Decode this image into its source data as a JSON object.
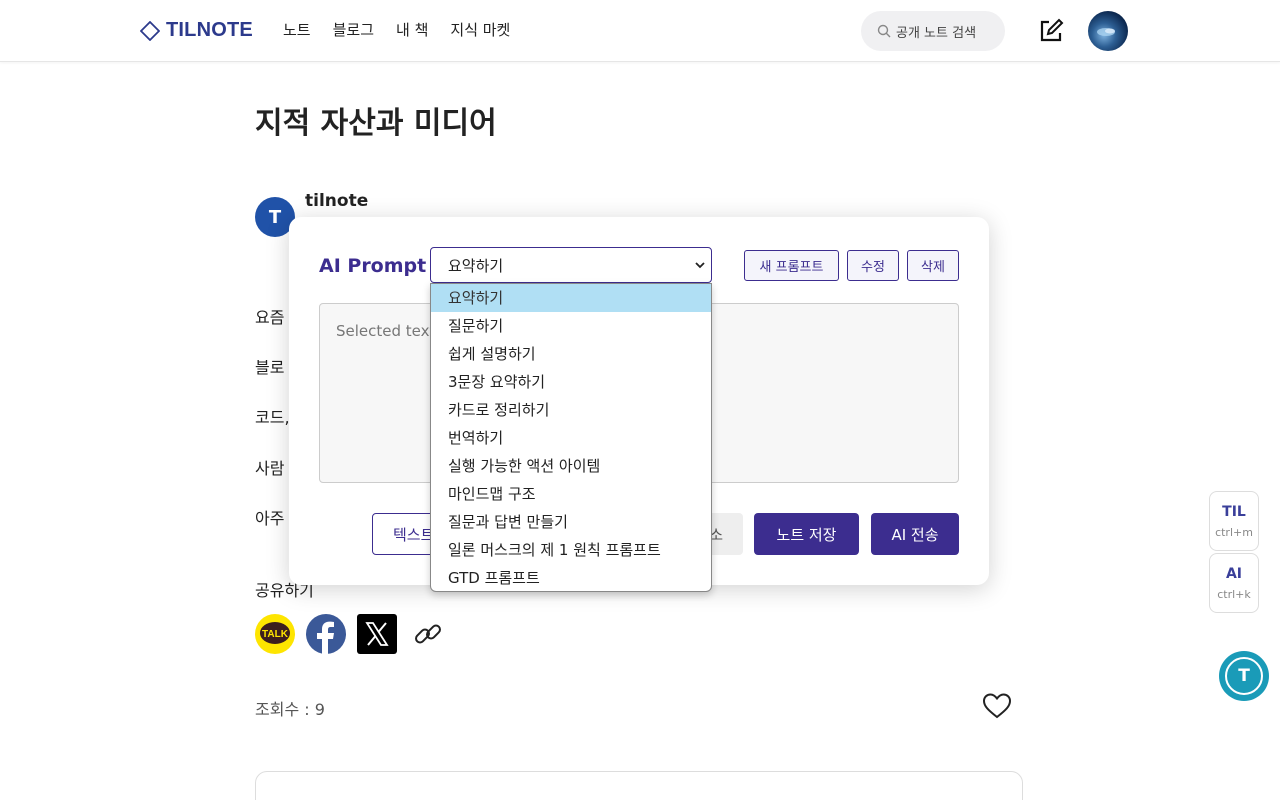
{
  "header": {
    "logo_text": "TILNOTE",
    "nav": [
      "노트",
      "블로그",
      "내 책",
      "지식 마켓"
    ],
    "search_placeholder": "공개 노트 검색"
  },
  "article": {
    "title": "지적 자산과 미디어",
    "author_initial": "T",
    "author_name": "tilnote",
    "body_lines": [
      "요즘",
      "블로",
      "코드,",
      "사람",
      "아주"
    ],
    "share_label": "공유하기",
    "views_label": "조회수 : 9"
  },
  "share": {
    "kakao_label": "TALK"
  },
  "floating": {
    "til_label": "TIL",
    "til_shortcut": "ctrl+m",
    "ai_label": "AI",
    "ai_shortcut": "ctrl+k",
    "circle_initial": "T"
  },
  "ai_modal": {
    "title": "AI Prompt",
    "selected_prompt": "요약하기",
    "new_prompt_label": "새 프롬프트",
    "edit_label": "수정",
    "delete_label": "삭제",
    "textarea_placeholder": "Selected text v",
    "text_button_label": "텍스트",
    "cancel_button_label": "소",
    "save_note_label": "노트 저장",
    "send_label": "AI 전송",
    "options": [
      "요약하기",
      "질문하기",
      "쉽게 설명하기",
      "3문장 요약하기",
      "카드로 정리하기",
      "번역하기",
      "실행 가능한 액션 아이템",
      "마인드맵 구조",
      "질문과 답변 만들기",
      "일론 머스크의 제 1 원칙 프롬프트",
      "GTD 프롬프트"
    ]
  },
  "colors": {
    "brand": "#2c3a8c",
    "accent": "#3c2d8f",
    "selected_option": "#b0dff4",
    "teal": "#1a9bb8"
  }
}
